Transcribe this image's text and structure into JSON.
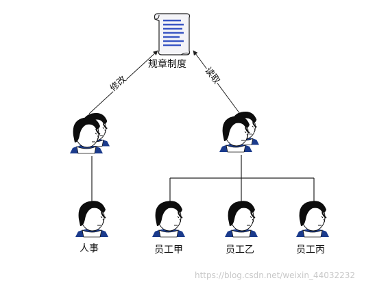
{
  "document": {
    "title": "规章制度",
    "actions": {
      "modify": "修改",
      "read": "读取"
    },
    "people": {
      "hr": "人事",
      "staff_a": "员工甲",
      "staff_b": "员工乙",
      "staff_c": "员工丙"
    },
    "watermark": "https://blog.csdn.net/weixin_44032232"
  },
  "colors": {
    "hair": "#0d0d0d",
    "skin": "#ffffff",
    "shirt": "#1b3b8c",
    "line": "#222222",
    "doc_lines": "#3a56c4"
  }
}
